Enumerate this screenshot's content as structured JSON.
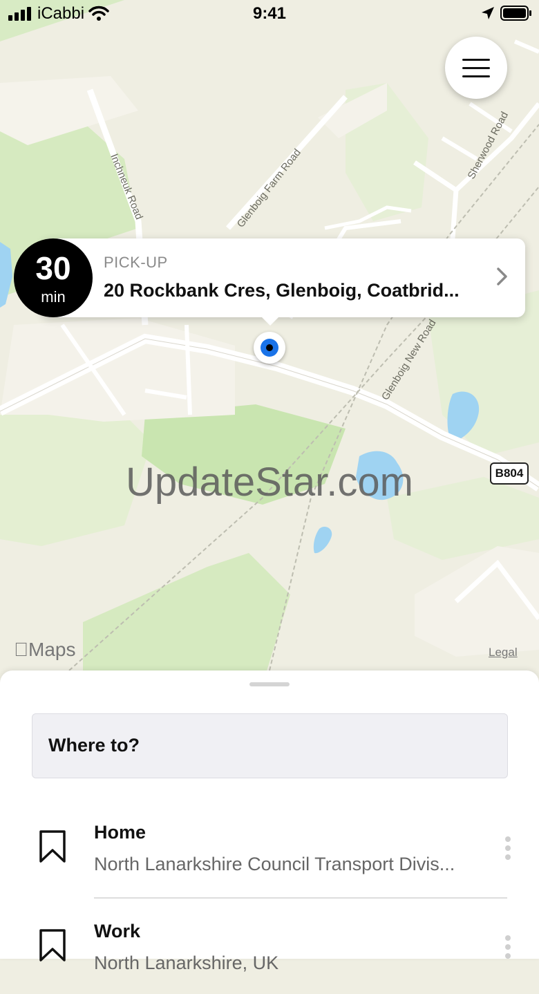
{
  "status_bar": {
    "carrier": "iCabbi",
    "time": "9:41"
  },
  "map": {
    "road_labels": [
      "Inchneuk Road",
      "Glenboig Farm Road",
      "Sherwood Road",
      "Glenboig New Road"
    ],
    "road_badge": "B804",
    "watermark": "UpdateStar.com",
    "maps_brand": "Maps",
    "legal_link": "Legal"
  },
  "eta": {
    "value": "30",
    "unit": "min"
  },
  "pickup": {
    "label": "PICK-UP",
    "address": "20 Rockbank Cres, Glenboig, Coatbrid..."
  },
  "search": {
    "placeholder": "Where to?"
  },
  "saved_places": [
    {
      "title": "Home",
      "subtitle": "North Lanarkshire Council Transport Divis..."
    },
    {
      "title": "Work",
      "subtitle": "North Lanarkshire, UK"
    }
  ],
  "colors": {
    "accent": "#1a73e8",
    "map_land": "#efeee2",
    "map_park": "#cfe6b8",
    "map_water": "#9fd3f2"
  },
  "icons": [
    "cellular-signal-icon",
    "wifi-icon",
    "location-arrow-icon",
    "battery-icon",
    "hamburger-menu-icon",
    "chevron-right-icon",
    "bookmark-icon",
    "more-vertical-icon",
    "apple-logo-icon"
  ]
}
